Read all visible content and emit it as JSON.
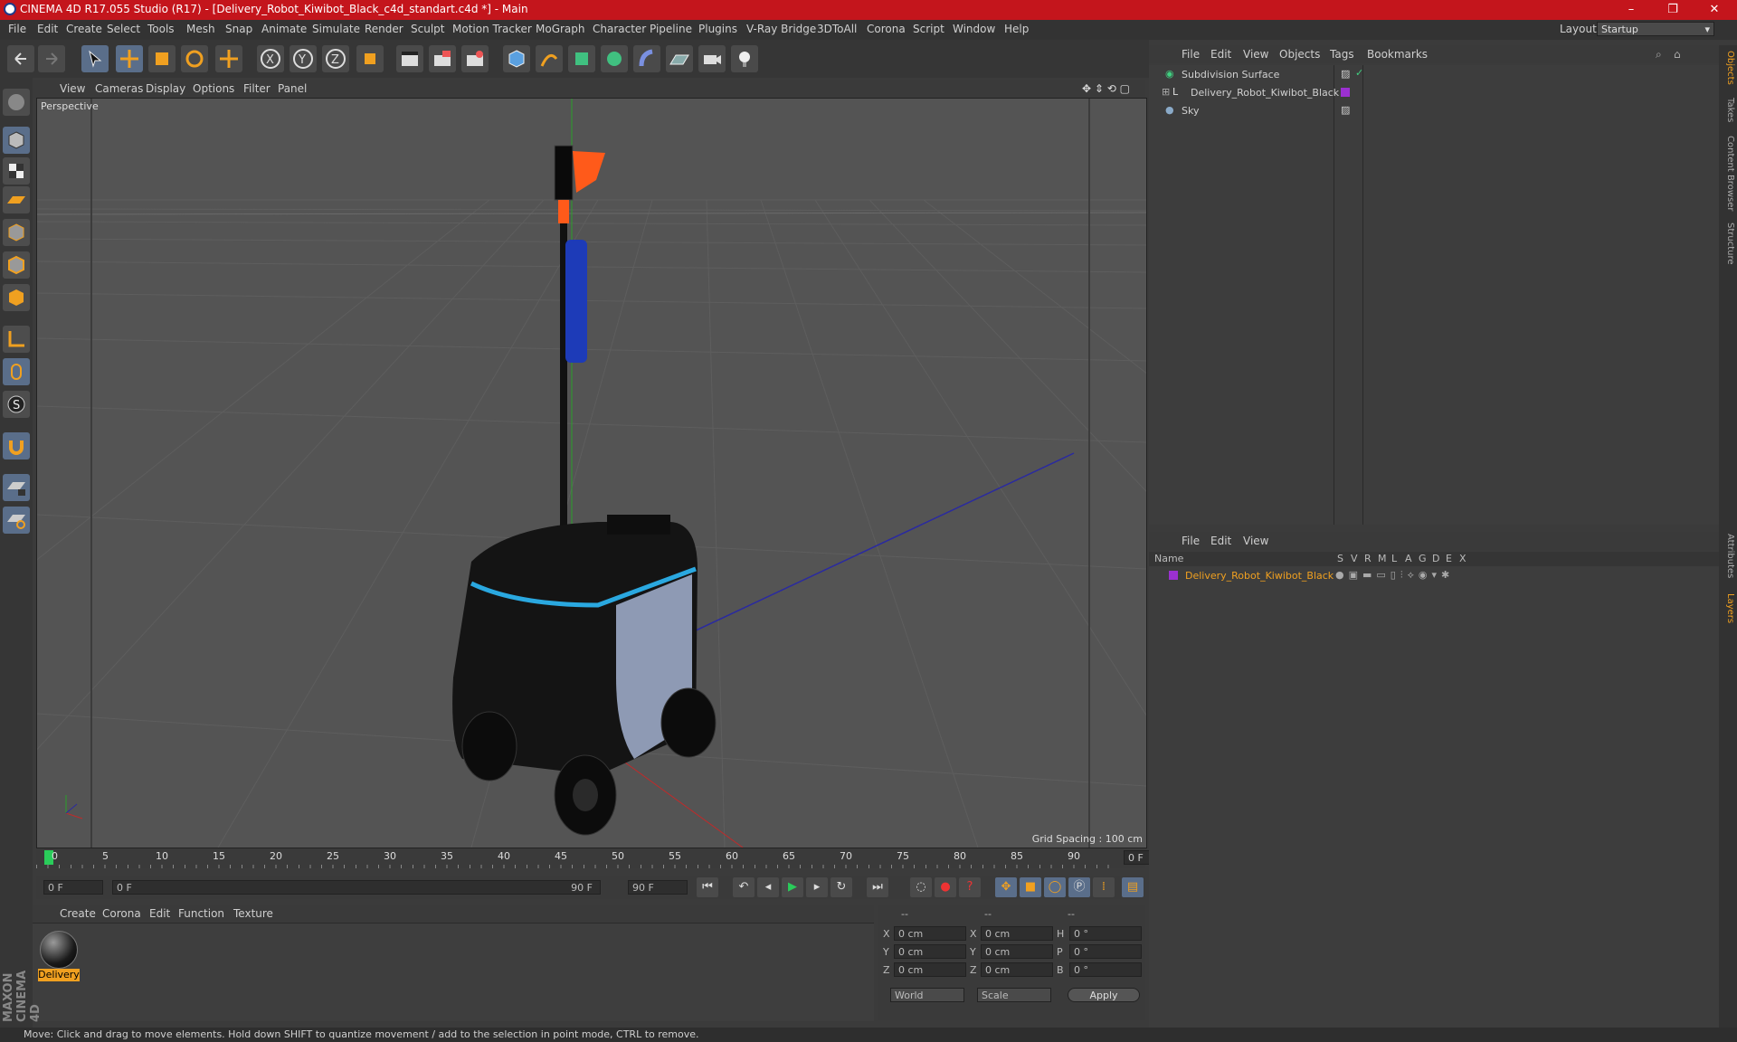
{
  "window": {
    "title": "CINEMA 4D R17.055 Studio (R17) - [Delivery_Robot_Kiwibot_Black_c4d_standart.c4d *] - Main",
    "minimize": "–",
    "maximize": "❐",
    "close": "✕"
  },
  "menubar": {
    "items": [
      "File",
      "Edit",
      "Create",
      "Select",
      "Tools",
      "Mesh",
      "Snap",
      "Animate",
      "Simulate",
      "Render",
      "Sculpt",
      "Motion Tracker",
      "MoGraph",
      "Character",
      "Pipeline",
      "Plugins",
      "V-Ray Bridge",
      "3DToAll",
      "Corona",
      "Script",
      "Window",
      "Help"
    ],
    "layout_label": "Layout:",
    "layout_value": "Startup"
  },
  "viewport": {
    "menu": [
      "View",
      "Cameras",
      "Display",
      "Options",
      "Filter",
      "Panel"
    ],
    "label": "Perspective",
    "grid_spacing": "Grid Spacing : 100 cm"
  },
  "timeline": {
    "ticks": [
      "0",
      "5",
      "10",
      "15",
      "20",
      "25",
      "30",
      "35",
      "40",
      "45",
      "50",
      "55",
      "60",
      "65",
      "70",
      "75",
      "80",
      "85",
      "90"
    ],
    "current_frame": "0 F",
    "start": "0 F",
    "range_start": "0 F",
    "range_end": "90 F",
    "end": "90 F"
  },
  "material_manager": {
    "menu": [
      "Create",
      "Corona",
      "Edit",
      "Function",
      "Texture"
    ],
    "material_name": "Delivery"
  },
  "coordinates": {
    "header": [
      "--",
      "--",
      "--"
    ],
    "rows": [
      {
        "a": "X",
        "av": "0 cm",
        "b": "X",
        "bv": "0 cm",
        "c": "H",
        "cv": "0 °"
      },
      {
        "a": "Y",
        "av": "0 cm",
        "b": "Y",
        "bv": "0 cm",
        "c": "P",
        "cv": "0 °"
      },
      {
        "a": "Z",
        "av": "0 cm",
        "b": "Z",
        "bv": "0 cm",
        "c": "B",
        "cv": "0 °"
      }
    ],
    "mode1": "World",
    "mode2": "Scale",
    "apply": "Apply"
  },
  "object_manager": {
    "menu": [
      "File",
      "Edit",
      "View",
      "Objects",
      "Tags",
      "Bookmarks"
    ],
    "objects": [
      "Subdivision Surface",
      "Delivery_Robot_Kiwibot_Black",
      "Sky"
    ]
  },
  "layer_manager": {
    "menu": [
      "File",
      "Edit",
      "View"
    ],
    "columns": [
      "Name",
      "S",
      "V",
      "R",
      "M",
      "L",
      "A",
      "G",
      "D",
      "E",
      "X"
    ],
    "layer_name": "Delivery_Robot_Kiwibot_Black"
  },
  "right_tabs": [
    "Objects",
    "Takes",
    "Content Browser",
    "Structure",
    "Attributes",
    "Layers"
  ],
  "status": "Move: Click and drag to move elements. Hold down SHIFT to quantize movement / add to the selection in point mode, CTRL to remove.",
  "brand": "MAXON CINEMA 4D",
  "colors": {
    "titlebar": "#c4151c",
    "accent": "#f0a020",
    "layer": "#9b30d0"
  }
}
